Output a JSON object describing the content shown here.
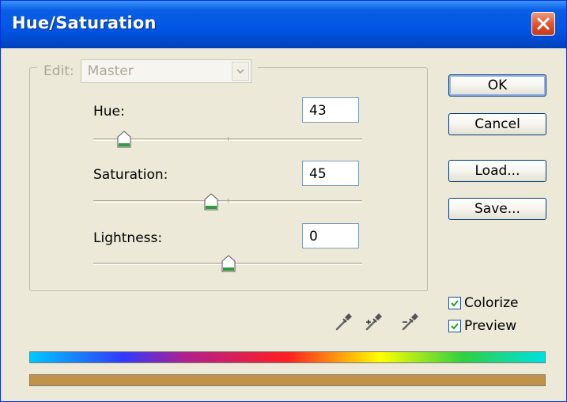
{
  "window": {
    "title": "Hue/Saturation"
  },
  "edit": {
    "label": "Edit:",
    "value": "Master"
  },
  "sliders": [
    {
      "label": "Hue:",
      "value": "43"
    },
    {
      "label": "Saturation:",
      "value": "45"
    },
    {
      "label": "Lightness:",
      "value": "0"
    }
  ],
  "buttons": {
    "ok": "OK",
    "cancel": "Cancel",
    "load": "Load...",
    "save": "Save..."
  },
  "checkboxes": {
    "colorize": {
      "label": "Colorize",
      "checked": true
    },
    "preview": {
      "label": "Preview",
      "checked": true
    }
  },
  "icons": {
    "close": "close-icon",
    "eyedropper": "eyedropper-icon",
    "eyedropper_add": "eyedropper-plus-icon",
    "eyedropper_subtract": "eyedropper-minus-icon"
  },
  "colors": {
    "titlebar": "#0055e5",
    "dialog_bg": "#ece9d8",
    "thumb_accent": "#2e9c3f",
    "result_bar": "#c0924a"
  }
}
